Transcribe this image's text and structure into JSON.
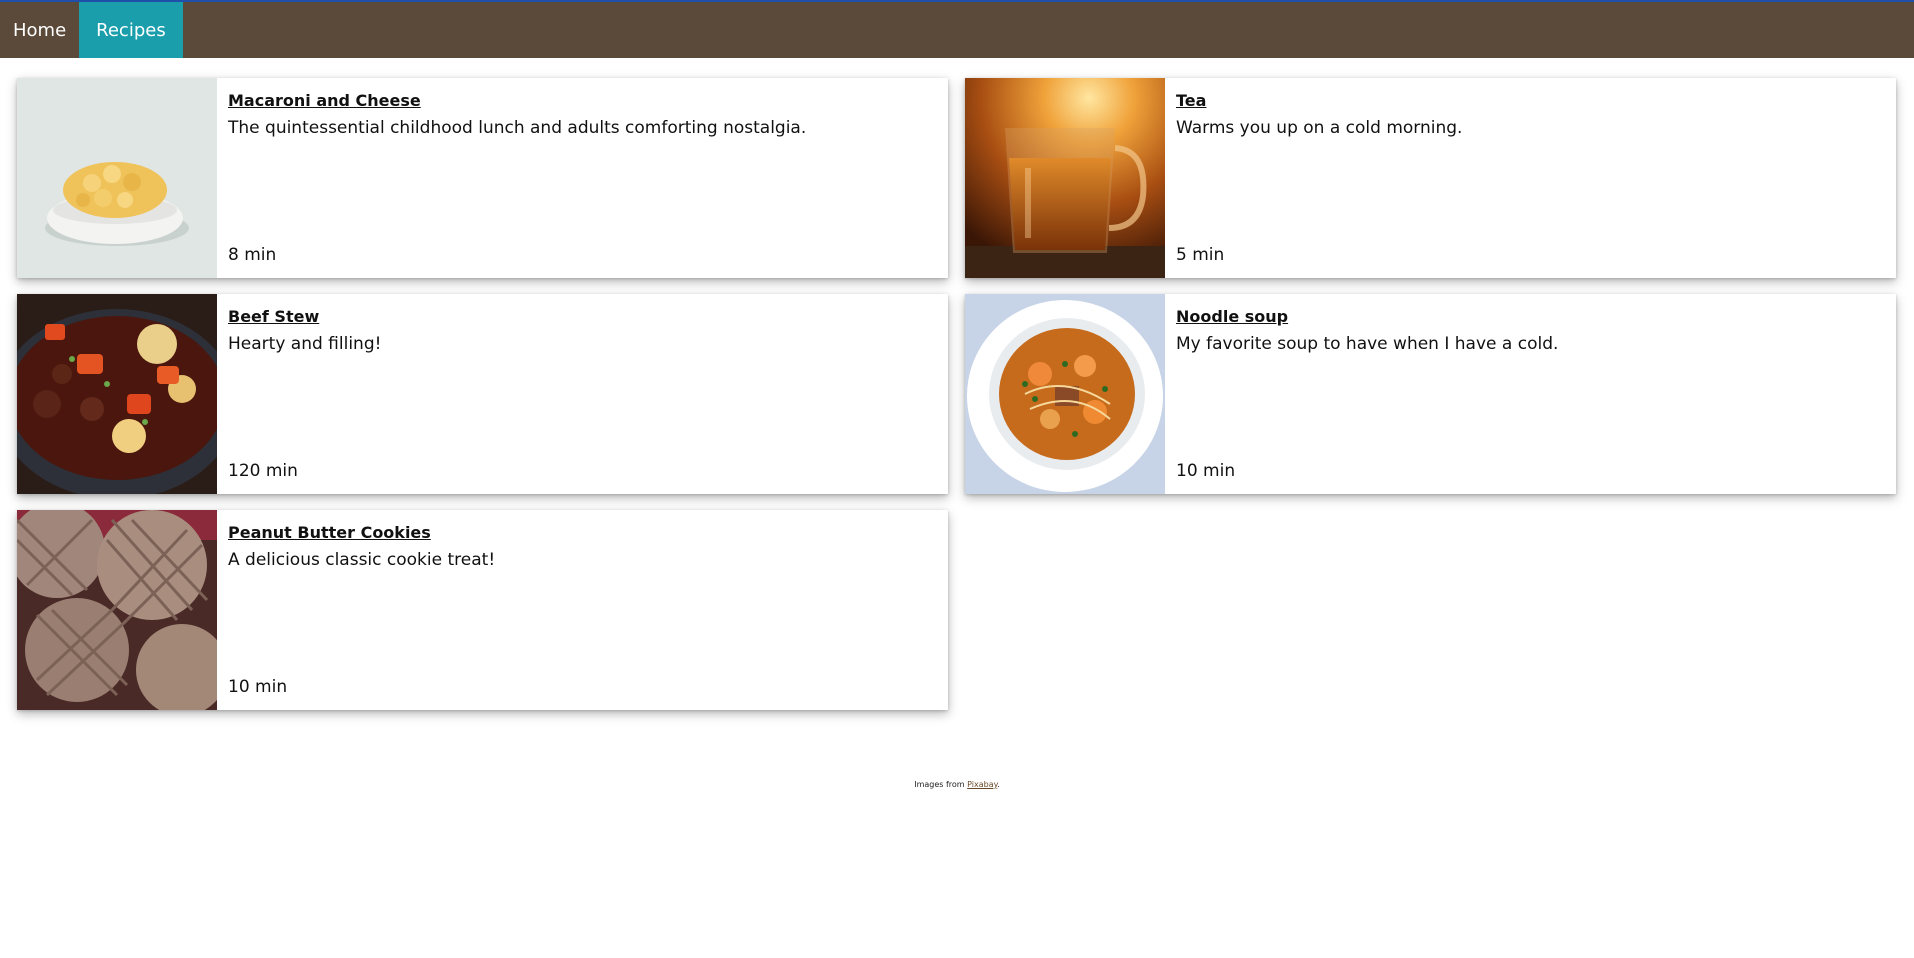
{
  "nav": {
    "items": [
      {
        "label": "Home",
        "active": false
      },
      {
        "label": "Recipes",
        "active": true
      }
    ],
    "colors": {
      "bar": "#5b4a3a",
      "active": "#1a9eab",
      "accent": "#1f4fa8"
    }
  },
  "recipes": [
    {
      "title": "Macaroni and Cheese",
      "description": "The quintessential childhood lunch and adults comforting nostalgia.",
      "time": "8 min",
      "image": "macaroni-and-cheese-photo"
    },
    {
      "title": "Tea",
      "description": "Warms you up on a cold morning.",
      "time": "5 min",
      "image": "tea-glass-photo"
    },
    {
      "title": "Beef Stew",
      "description": "Hearty and filling!",
      "time": "120 min",
      "image": "beef-stew-photo"
    },
    {
      "title": "Noodle soup",
      "description": "My favorite soup to have when I have a cold.",
      "time": "10 min",
      "image": "noodle-soup-photo"
    },
    {
      "title": "Peanut Butter Cookies",
      "description": "A delicious classic cookie treat!",
      "time": "10 min",
      "image": "peanut-butter-cookies-photo"
    }
  ],
  "footer": {
    "prefix": "Images from ",
    "link_text": "Pixabay",
    "suffix": "."
  }
}
